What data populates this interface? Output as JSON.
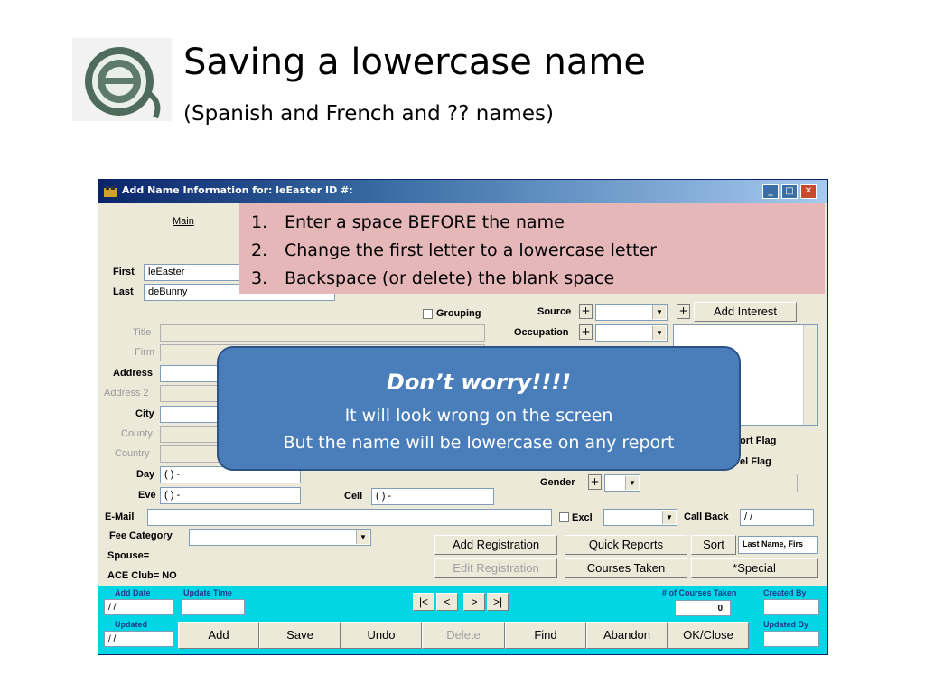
{
  "slide": {
    "title": "Saving a lowercase name",
    "subtitle": "(Spanish and French and ?? names)"
  },
  "window": {
    "title": "Add Name Information for:  leEaster   ID #:",
    "tab_main": "Main",
    "first_label": "First",
    "first_value": "leEaster",
    "last_label": "Last",
    "last_value": "deBunny",
    "grouping_label": "Grouping",
    "title_label": "Title",
    "firm_label": "Firm",
    "address_label": "Address",
    "address2_label": "Address 2",
    "city_label": "City",
    "county_label": "County",
    "country_label": "Country",
    "day_label": "Day",
    "day_value": "(  )  -",
    "eve_label": "Eve",
    "eve_value": "(  )  -",
    "cell_label": "Cell",
    "cell_value": "(  )  -",
    "email_label": "E-Mail",
    "excl_label": "Excl",
    "call_back_label": "Call Back",
    "call_back_value": " / /",
    "fee_category_label": "Fee Category",
    "spouse_label": "Spouse=",
    "ace_club_label": "ACE Club= NO",
    "source_label": "Source",
    "occupation_label": "Occupation",
    "plus": "+",
    "add_interest": "Add  Interest",
    "sort_flag_partial": "ort Flag",
    "sel_flag_partial": "el Flag",
    "gender_label": "Gender",
    "add_registration": "Add Registration",
    "quick_reports": "Quick Reports",
    "sort": "Sort",
    "sort_value": "Last Name, Firs",
    "edit_registration": "Edit Registration",
    "courses_taken": "Courses Taken",
    "special": "*Special",
    "add_date_label": "Add Date",
    "add_date_value": " / /",
    "update_time_label": "Update Time",
    "nav_first": "|<",
    "nav_prev": "<",
    "nav_next": ">",
    "nav_last": ">|",
    "courses_taken_count_label": "# of Courses Taken",
    "courses_taken_count": "0",
    "created_by_label": "Created By",
    "updated_label": "Updated",
    "updated_value": " / /",
    "updated_by_label": "Updated By",
    "add_button": "Add",
    "save_button": "Save",
    "undo_button": "Undo",
    "delete_button": "Delete",
    "find_button": "Find",
    "abandon_button": "Abandon",
    "ok_close_button": "OK/Close"
  },
  "steps": [
    {
      "num": "1.",
      "text": "Enter a space BEFORE the name"
    },
    {
      "num": "2.",
      "text": "Change the first letter to a lowercase letter"
    },
    {
      "num": "3.",
      "text": "Backspace (or delete) the blank space"
    }
  ],
  "note": {
    "heading": "Don’t worry!!!!",
    "line1": "It will look wrong on the screen",
    "line2": "But the name will be lowercase on any report"
  },
  "colors": {
    "callout_pink": "#e6b7b8",
    "callout_blue": "#4a7ebb",
    "status_bar_cyan": "#00d6e4"
  }
}
